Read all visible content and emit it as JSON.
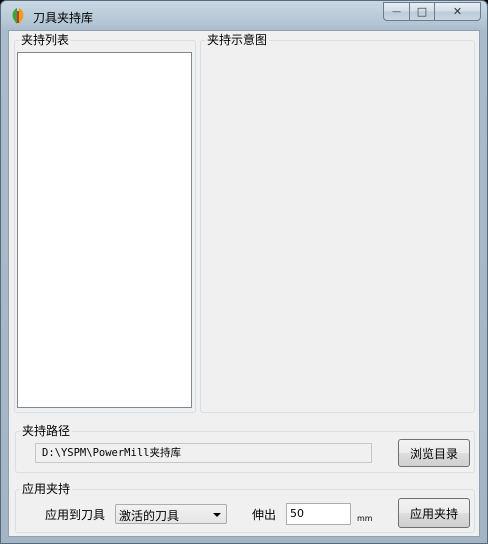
{
  "window": {
    "title": "刀具夹持库",
    "minimize_glyph": "—",
    "maximize_glyph": "□",
    "close_glyph": "✕"
  },
  "list_group": {
    "title": "夹持列表",
    "items": []
  },
  "preview_group": {
    "title": "夹持示意图"
  },
  "path_group": {
    "title": "夹持路径",
    "path_value": "D:\\YSPM\\PowerMill夹持库",
    "browse_button": "浏览目录"
  },
  "apply_group": {
    "title": "应用夹持",
    "apply_to_label": "应用到刀具",
    "apply_to_selected": "激活的刀具",
    "extend_label": "伸出",
    "extend_value": "50",
    "unit": "mm",
    "apply_button": "应用夹持"
  },
  "colors": {
    "titlebar_top": "#c9d8e4",
    "client_bg": "#f0f0f0",
    "icon_green": "#3aa43a",
    "icon_orange": "#f39c1c"
  }
}
